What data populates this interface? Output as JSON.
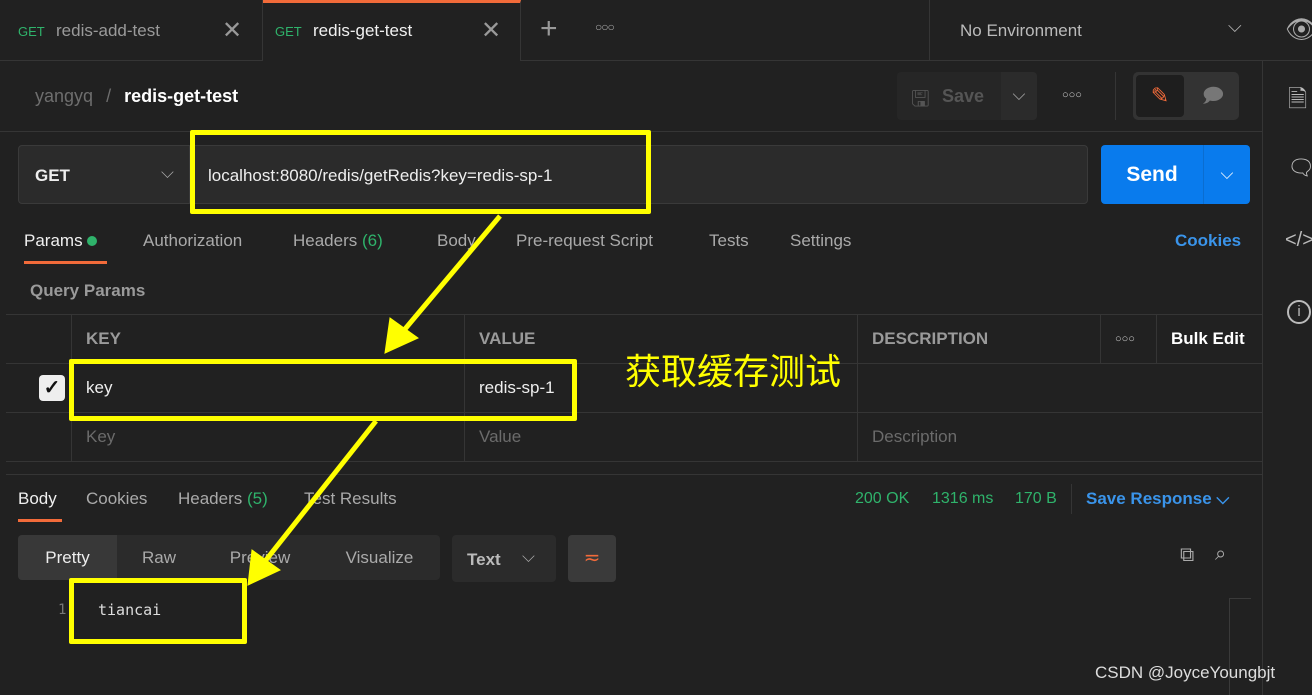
{
  "tabs": [
    {
      "method": "GET",
      "name": "redis-add-test",
      "active": false
    },
    {
      "method": "GET",
      "name": "redis-get-test",
      "active": true
    }
  ],
  "environment": "No Environment",
  "breadcrumb": {
    "workspace": "yangyq",
    "separator": "/",
    "request": "redis-get-test"
  },
  "toolbar": {
    "save_label": "Save"
  },
  "request": {
    "method": "GET",
    "url": "localhost:8080/redis/getRedis?key=redis-sp-1",
    "send_label": "Send"
  },
  "request_tabs": {
    "params": "Params",
    "authorization": "Authorization",
    "headers": "Headers",
    "headers_count": "(6)",
    "body": "Body",
    "prerequest": "Pre-request Script",
    "tests": "Tests",
    "settings": "Settings",
    "cookies": "Cookies"
  },
  "query_params": {
    "title": "Query Params",
    "columns": {
      "key": "KEY",
      "value": "VALUE",
      "description": "DESCRIPTION",
      "bulk_edit": "Bulk Edit"
    },
    "rows": [
      {
        "checked": true,
        "key": "key",
        "value": "redis-sp-1",
        "description": ""
      }
    ],
    "placeholder": {
      "key": "Key",
      "value": "Value",
      "description": "Description"
    }
  },
  "response": {
    "tabs": {
      "body": "Body",
      "cookies": "Cookies",
      "headers": "Headers",
      "headers_count": "(5)",
      "tests": "Test Results"
    },
    "status": "200 OK",
    "time": "1316 ms",
    "size": "170 B",
    "save_response": "Save Response",
    "views": [
      "Pretty",
      "Raw",
      "Preview",
      "Visualize"
    ],
    "format": "Text",
    "lines": [
      {
        "number": "1",
        "text": "tiancai"
      }
    ]
  },
  "annotation": {
    "text": "获取缓存测试",
    "color": "#ffff00"
  },
  "watermark": "CSDN @JoyceYoungbjt",
  "colors": {
    "accent": "#f26b3a",
    "send": "#097bed",
    "status": "#2fb36b",
    "link": "#3a94ea"
  }
}
